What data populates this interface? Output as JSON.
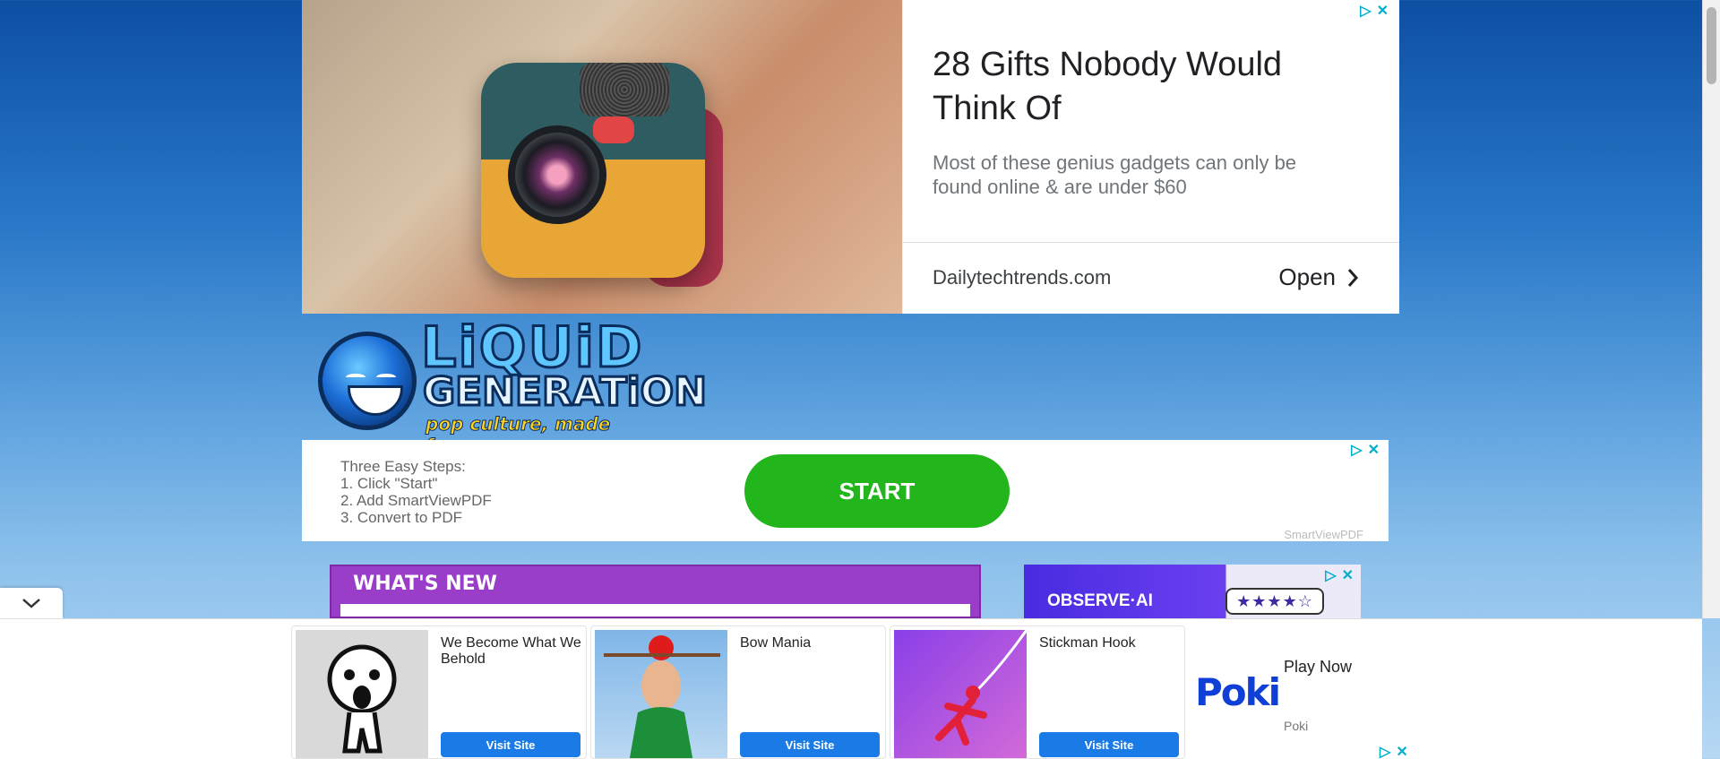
{
  "top_ad": {
    "title": "28 Gifts Nobody Would Think Of",
    "description": "Most of these genius gadgets can only be found online & are under $60",
    "domain": "Dailytechtrends.com",
    "cta": "Open"
  },
  "logo": {
    "line1": "LiQUiD",
    "line2": "GENERATiON",
    "tagline": "pop culture, made funny."
  },
  "pdf_ad": {
    "steps": [
      "Three Easy Steps:",
      "1. Click \"Start\"",
      "2. Add SmartViewPDF",
      "3. Convert to PDF"
    ],
    "button": "START",
    "brand": "SmartViewPDF"
  },
  "whats_new": {
    "heading": "WHAT'S NEW"
  },
  "observe_ad": {
    "brand": "OBSERVE·AI",
    "stars": "★★★★☆"
  },
  "games": [
    {
      "name": "We Become What We Behold",
      "cta": "Visit Site"
    },
    {
      "name": "Bow Mania",
      "cta": "Visit Site"
    },
    {
      "name": "Stickman Hook",
      "cta": "Visit Site"
    }
  ],
  "poki": {
    "logo": "Poki",
    "cta": "Play Now",
    "name": "Poki"
  },
  "colors": {
    "accent_blue": "#1b7be6",
    "start_green": "#22b51c",
    "purple": "#9a3ec9",
    "adchoice": "#00aecd"
  }
}
